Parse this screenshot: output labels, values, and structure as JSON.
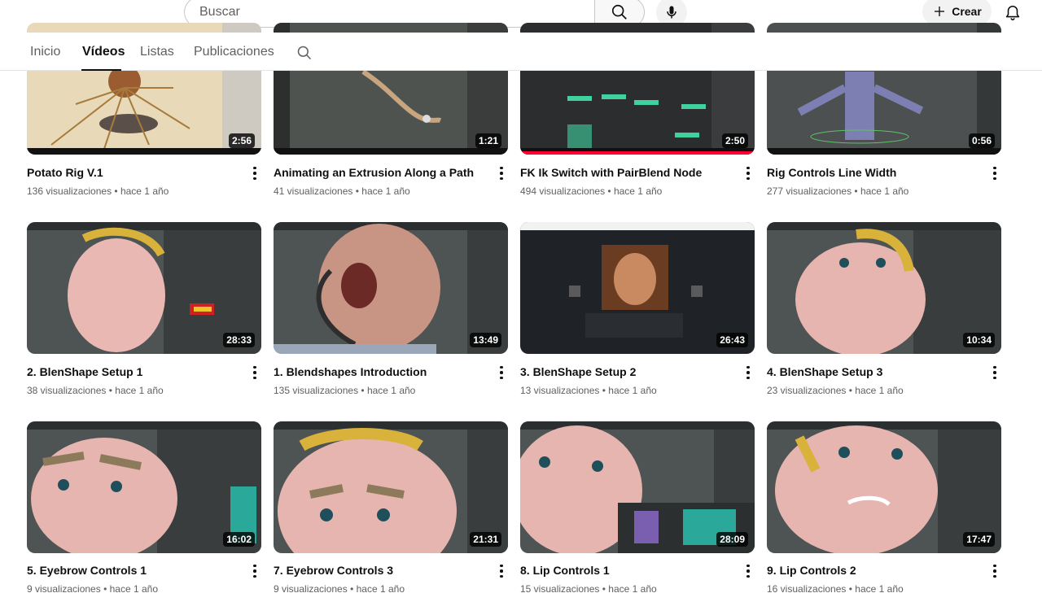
{
  "search": {
    "placeholder": "Buscar"
  },
  "header": {
    "create_label": "Crear"
  },
  "tabs": [
    {
      "label": "Inicio"
    },
    {
      "label": "Vídeos"
    },
    {
      "label": "Listas"
    },
    {
      "label": "Publicaciones"
    }
  ],
  "videos": [
    {
      "title": "Potato Rig V.1",
      "views": "136 visualizaciones",
      "age": "hace 1 año",
      "duration": "2:56"
    },
    {
      "title": "Animating an Extrusion Along a Path",
      "views": "41 visualizaciones",
      "age": "hace 1 año",
      "duration": "1:21"
    },
    {
      "title": "FK Ik Switch with PairBlend Node",
      "views": "494 visualizaciones",
      "age": "hace 1 año",
      "duration": "2:50"
    },
    {
      "title": "Rig Controls Line Width",
      "views": "277 visualizaciones",
      "age": "hace 1 año",
      "duration": "0:56"
    },
    {
      "title": "2. BlenShape Setup 1",
      "views": "38 visualizaciones",
      "age": "hace 1 año",
      "duration": "28:33"
    },
    {
      "title": "1. Blendshapes Introduction",
      "views": "135 visualizaciones",
      "age": "hace 1 año",
      "duration": "13:49"
    },
    {
      "title": "3. BlenShape Setup 2",
      "views": "13 visualizaciones",
      "age": "hace 1 año",
      "duration": "26:43"
    },
    {
      "title": "4. BlenShape Setup 3",
      "views": "23 visualizaciones",
      "age": "hace 1 año",
      "duration": "10:34"
    },
    {
      "title": "5. Eyebrow Controls 1",
      "views": "9 visualizaciones",
      "age": "hace 1 año",
      "duration": "16:02"
    },
    {
      "title": "7. Eyebrow Controls 3",
      "views": "9 visualizaciones",
      "age": "hace 1 año",
      "duration": "21:31"
    },
    {
      "title": "8. Lip Controls 1",
      "views": "15 visualizaciones",
      "age": "hace 1 año",
      "duration": "28:09"
    },
    {
      "title": "9. Lip Controls 2",
      "views": "16 visualizaciones",
      "age": "hace 1 año",
      "duration": "17:47"
    }
  ],
  "separator": "•",
  "colors": {
    "accent": "#ff0033",
    "text_primary": "#0f0f0f",
    "text_secondary": "#606060"
  }
}
